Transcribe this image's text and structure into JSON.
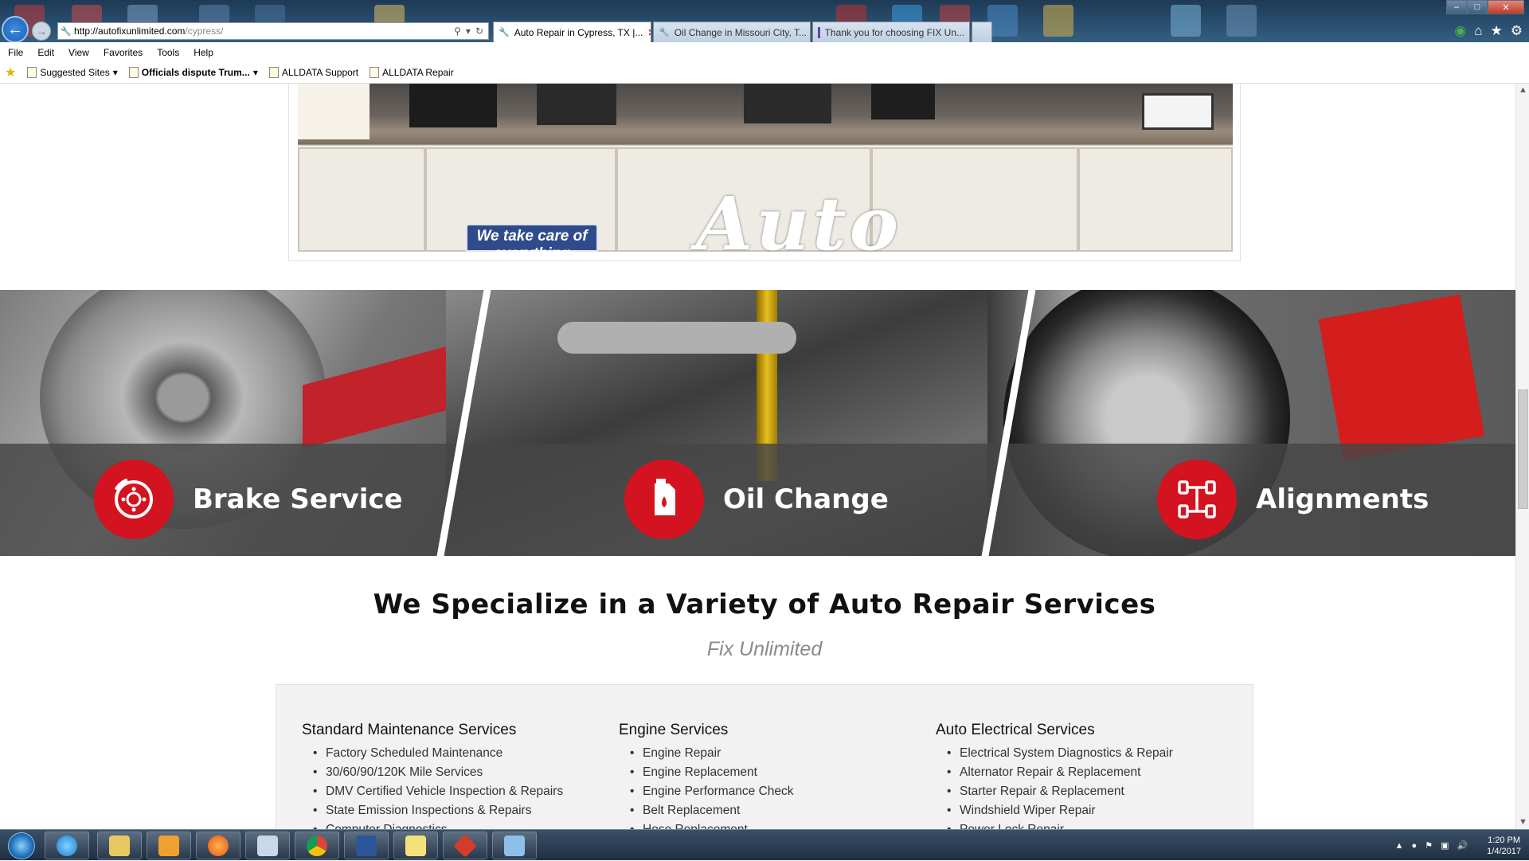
{
  "browser": {
    "address": {
      "url_host": "http://autofixunlimited.com",
      "url_path": "/cypress/"
    },
    "tabs": [
      {
        "label": "Auto Repair in Cypress, TX |..."
      },
      {
        "label": "Oil Change in Missouri City, T..."
      },
      {
        "label": "Thank you for choosing FIX Un..."
      }
    ],
    "menu": [
      "File",
      "Edit",
      "View",
      "Favorites",
      "Tools",
      "Help"
    ],
    "favorites": [
      {
        "label": "Suggested Sites"
      },
      {
        "label": "Officials dispute Trum..."
      },
      {
        "label": "ALLDATA Support"
      },
      {
        "label": "ALLDATA Repair"
      }
    ]
  },
  "hero": {
    "sign_text": "We take care of",
    "sign_text_2": "everything",
    "brand_text": "Auto"
  },
  "service_banner": [
    {
      "label": "Brake Service",
      "icon": "brake-disc-icon"
    },
    {
      "label": "Oil Change",
      "icon": "oil-can-icon"
    },
    {
      "label": "Alignments",
      "icon": "wheel-alignment-icon"
    }
  ],
  "section": {
    "heading": "We Specialize in a Variety of Auto Repair Services",
    "subheading": "Fix Unlimited"
  },
  "service_columns": [
    {
      "title": "Standard Maintenance Services",
      "items": [
        "Factory Scheduled Maintenance",
        "30/60/90/120K Mile Services",
        "DMV Certified Vehicle Inspection & Repairs",
        "State Emission Inspections & Repairs",
        "Computer Diagnostics"
      ]
    },
    {
      "title": "Engine Services",
      "items": [
        "Engine Repair",
        "Engine Replacement",
        "Engine Performance Check",
        "Belt Replacement",
        "Hose Replacement"
      ]
    },
    {
      "title": "Auto Electrical Services",
      "items": [
        "Electrical System Diagnostics & Repair",
        "Alternator Repair & Replacement",
        "Starter Repair & Replacement",
        "Windshield Wiper Repair",
        "Power Lock Repair"
      ]
    }
  ],
  "taskbar": {
    "time": "1:20 PM",
    "date": "1/4/2017"
  },
  "colors": {
    "brand_red": "#d3131f",
    "banner_band": "#464646",
    "box_bg": "#f2f2f2"
  }
}
